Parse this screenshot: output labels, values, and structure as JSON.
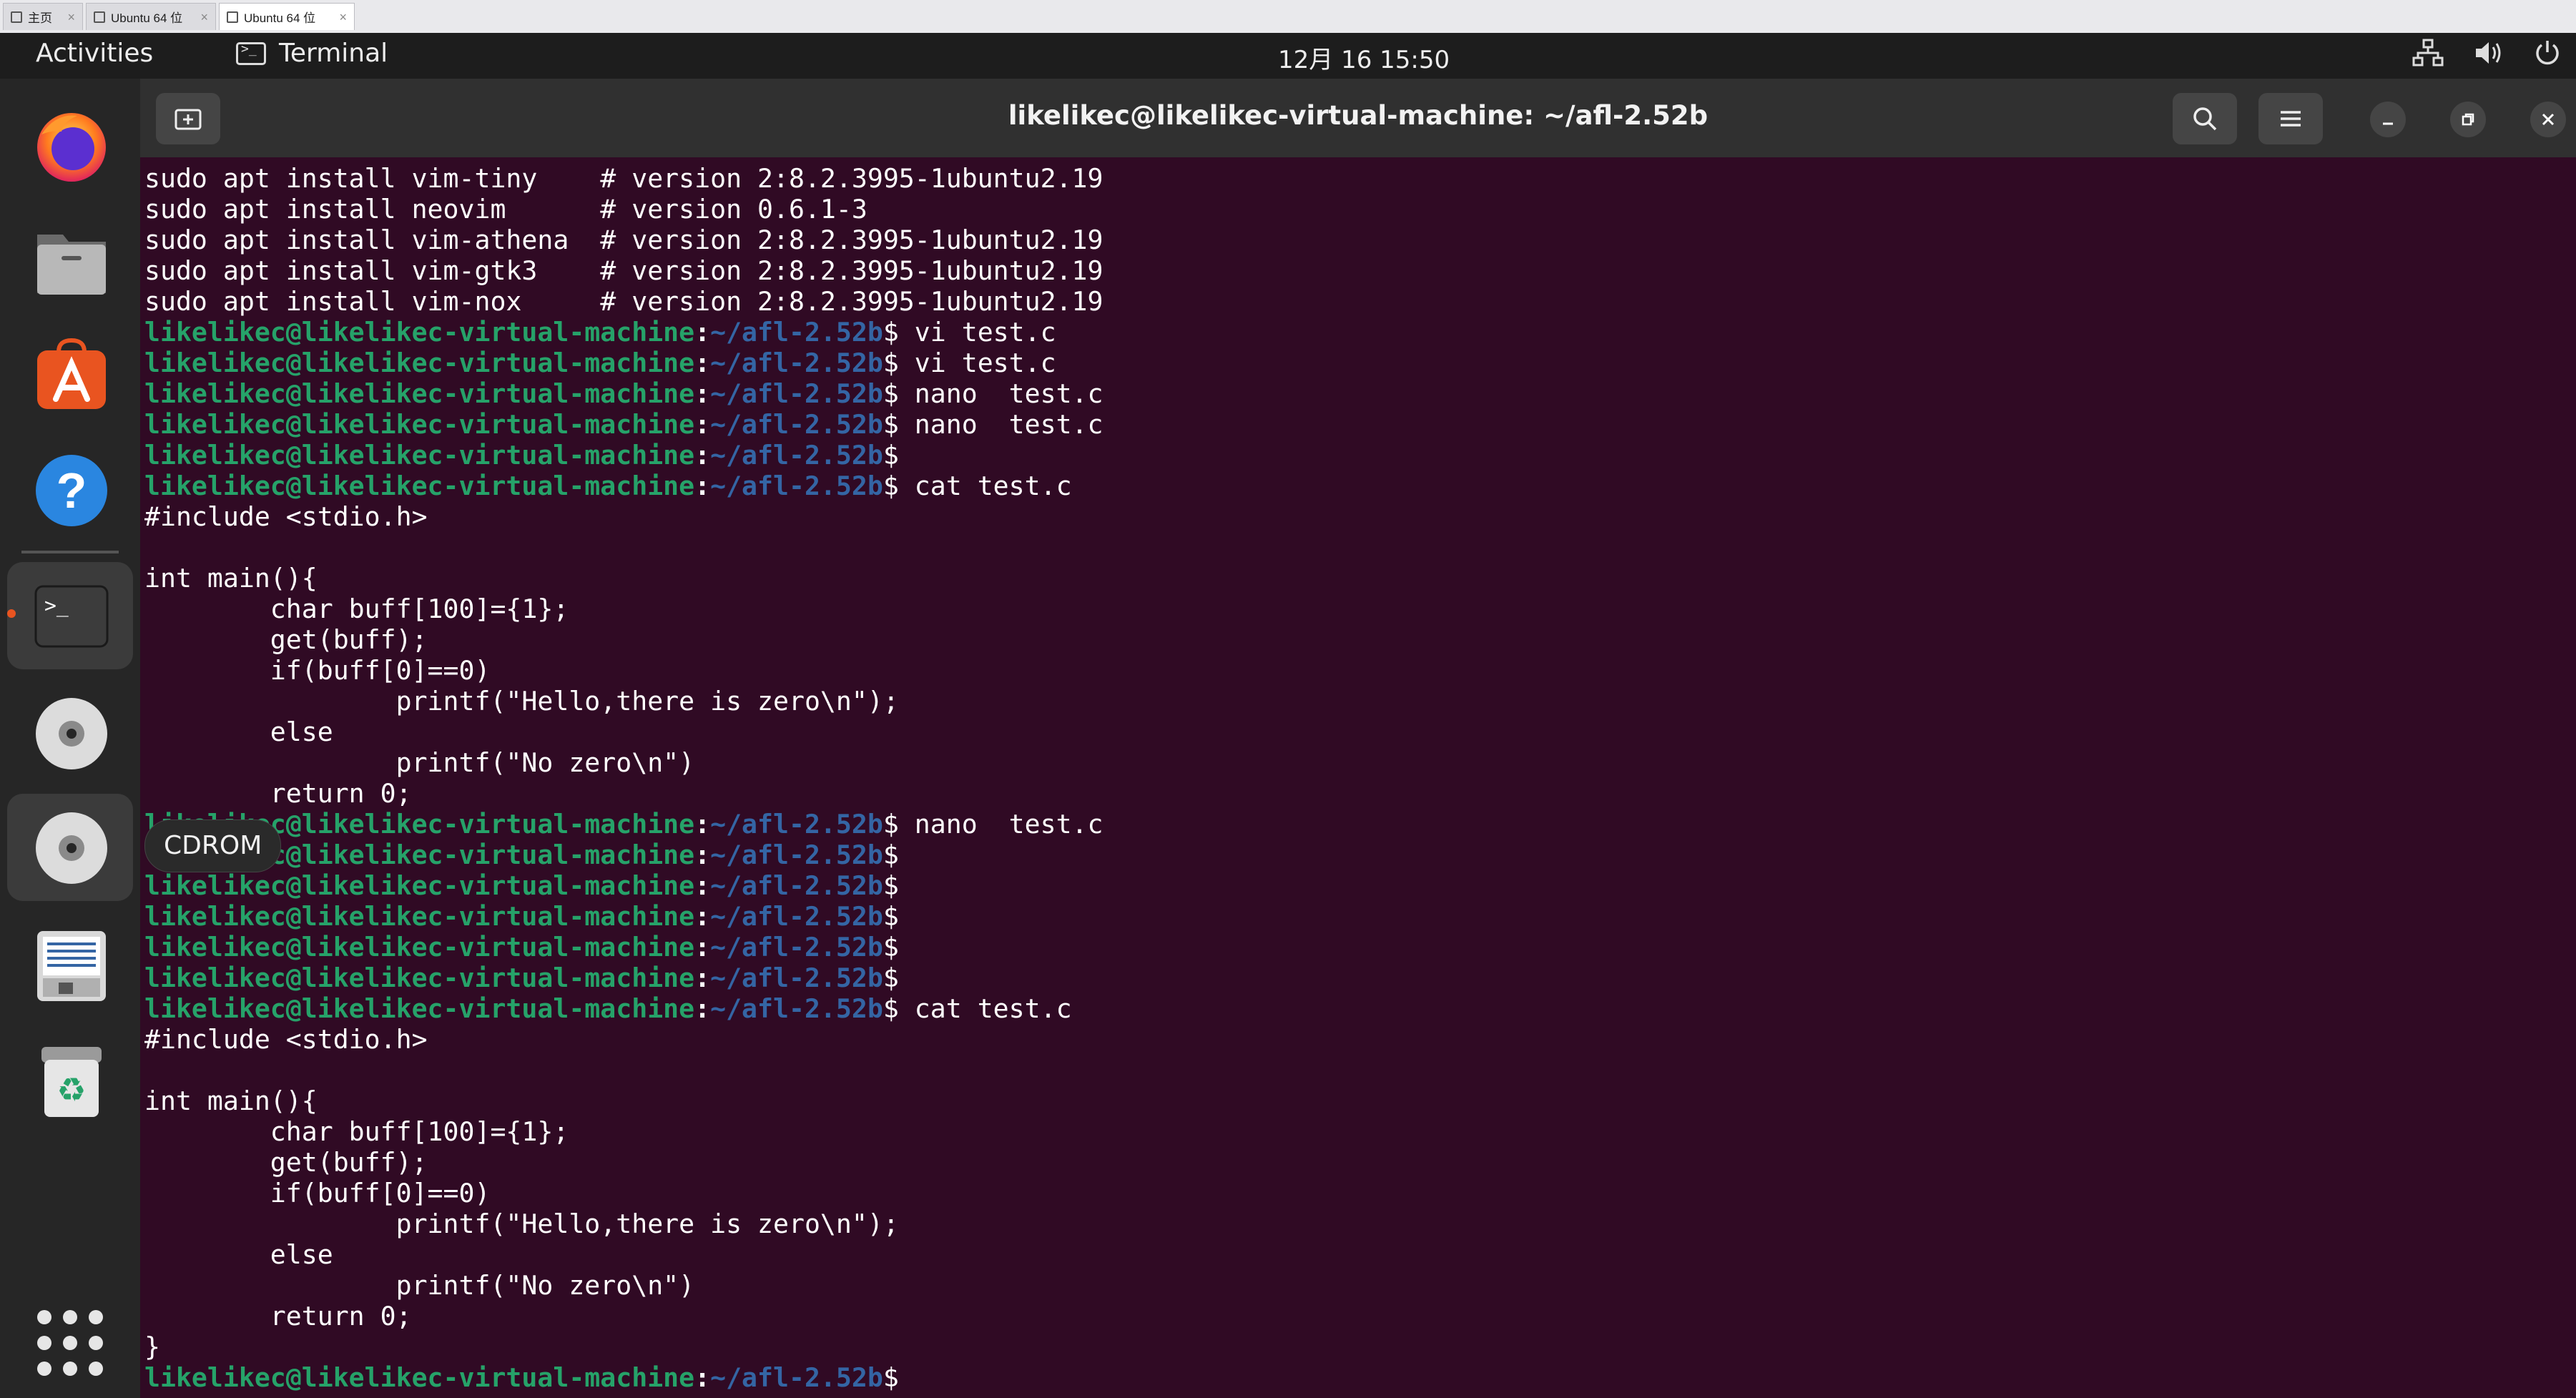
{
  "vm_tabs": [
    {
      "label": "主页",
      "active": false
    },
    {
      "label": "Ubuntu 64 位",
      "active": false
    },
    {
      "label": "Ubuntu 64 位",
      "active": true
    }
  ],
  "topbar": {
    "activities": "Activities",
    "app_name": "Terminal",
    "clock": "12月 16  15:50",
    "tray_icons": [
      "network-icon",
      "volume-icon",
      "power-icon"
    ]
  },
  "dock": {
    "items": [
      {
        "name": "firefox",
        "icon": "firefox-icon"
      },
      {
        "name": "files",
        "icon": "files-icon"
      },
      {
        "name": "app-center",
        "icon": "app-center-icon"
      },
      {
        "name": "help",
        "icon": "help-icon"
      },
      {
        "name": "terminal",
        "icon": "terminal-icon",
        "active": true
      },
      {
        "name": "disc",
        "icon": "disc-icon"
      },
      {
        "name": "cdrom",
        "icon": "disc-icon"
      },
      {
        "name": "text-editor",
        "icon": "text-editor-icon"
      },
      {
        "name": "trash",
        "icon": "trash-icon"
      }
    ],
    "tooltip": "CDROM",
    "show_apps_icon": "grid-icon"
  },
  "window": {
    "title": "likelikec@likelikec-virtual-machine: ~/afl-2.52b",
    "prompt": {
      "user_host": "likelikec@likelikec-virtual-machine",
      "path": "~/afl-2.52b"
    },
    "colors": {
      "background": "#300a24",
      "prompt_user": "#26a269",
      "prompt_path": "#3465a4",
      "text": "#ffffff"
    }
  },
  "terminal_lines": [
    {
      "type": "out",
      "text": "sudo apt install vim-tiny    # version 2:8.2.3995-1ubuntu2.19"
    },
    {
      "type": "out",
      "text": "sudo apt install neovim      # version 0.6.1-3"
    },
    {
      "type": "out",
      "text": "sudo apt install vim-athena  # version 2:8.2.3995-1ubuntu2.19"
    },
    {
      "type": "out",
      "text": "sudo apt install vim-gtk3    # version 2:8.2.3995-1ubuntu2.19"
    },
    {
      "type": "out",
      "text": "sudo apt install vim-nox     # version 2:8.2.3995-1ubuntu2.19"
    },
    {
      "type": "prompt",
      "cmd": " vi test.c"
    },
    {
      "type": "prompt",
      "cmd": " vi test.c"
    },
    {
      "type": "prompt",
      "cmd": " nano  test.c"
    },
    {
      "type": "prompt",
      "cmd": " nano  test.c"
    },
    {
      "type": "prompt",
      "cmd": ""
    },
    {
      "type": "prompt",
      "cmd": " cat test.c"
    },
    {
      "type": "out",
      "text": "#include <stdio.h>"
    },
    {
      "type": "out",
      "text": ""
    },
    {
      "type": "out",
      "text": "int main(){"
    },
    {
      "type": "out",
      "text": "        char buff[100]={1};"
    },
    {
      "type": "out",
      "text": "        get(buff);"
    },
    {
      "type": "out",
      "text": "        if(buff[0]==0)"
    },
    {
      "type": "out",
      "text": "                printf(\"Hello,there is zero\\n\");"
    },
    {
      "type": "out",
      "text": "        else"
    },
    {
      "type": "out",
      "text": "                printf(\"No zero\\n\")"
    },
    {
      "type": "out",
      "text": "        return 0;"
    },
    {
      "type": "prompt",
      "cmd": " nano  test.c"
    },
    {
      "type": "prompt",
      "cmd": ""
    },
    {
      "type": "prompt",
      "cmd": ""
    },
    {
      "type": "prompt",
      "cmd": ""
    },
    {
      "type": "prompt",
      "cmd": ""
    },
    {
      "type": "prompt",
      "cmd": ""
    },
    {
      "type": "prompt",
      "cmd": " cat test.c"
    },
    {
      "type": "out",
      "text": "#include <stdio.h>"
    },
    {
      "type": "out",
      "text": ""
    },
    {
      "type": "out",
      "text": "int main(){"
    },
    {
      "type": "out",
      "text": "        char buff[100]={1};"
    },
    {
      "type": "out",
      "text": "        get(buff);"
    },
    {
      "type": "out",
      "text": "        if(buff[0]==0)"
    },
    {
      "type": "out",
      "text": "                printf(\"Hello,there is zero\\n\");"
    },
    {
      "type": "out",
      "text": "        else"
    },
    {
      "type": "out",
      "text": "                printf(\"No zero\\n\")"
    },
    {
      "type": "out",
      "text": "        return 0;"
    },
    {
      "type": "out",
      "text": "}"
    },
    {
      "type": "prompt",
      "cmd": ""
    }
  ]
}
